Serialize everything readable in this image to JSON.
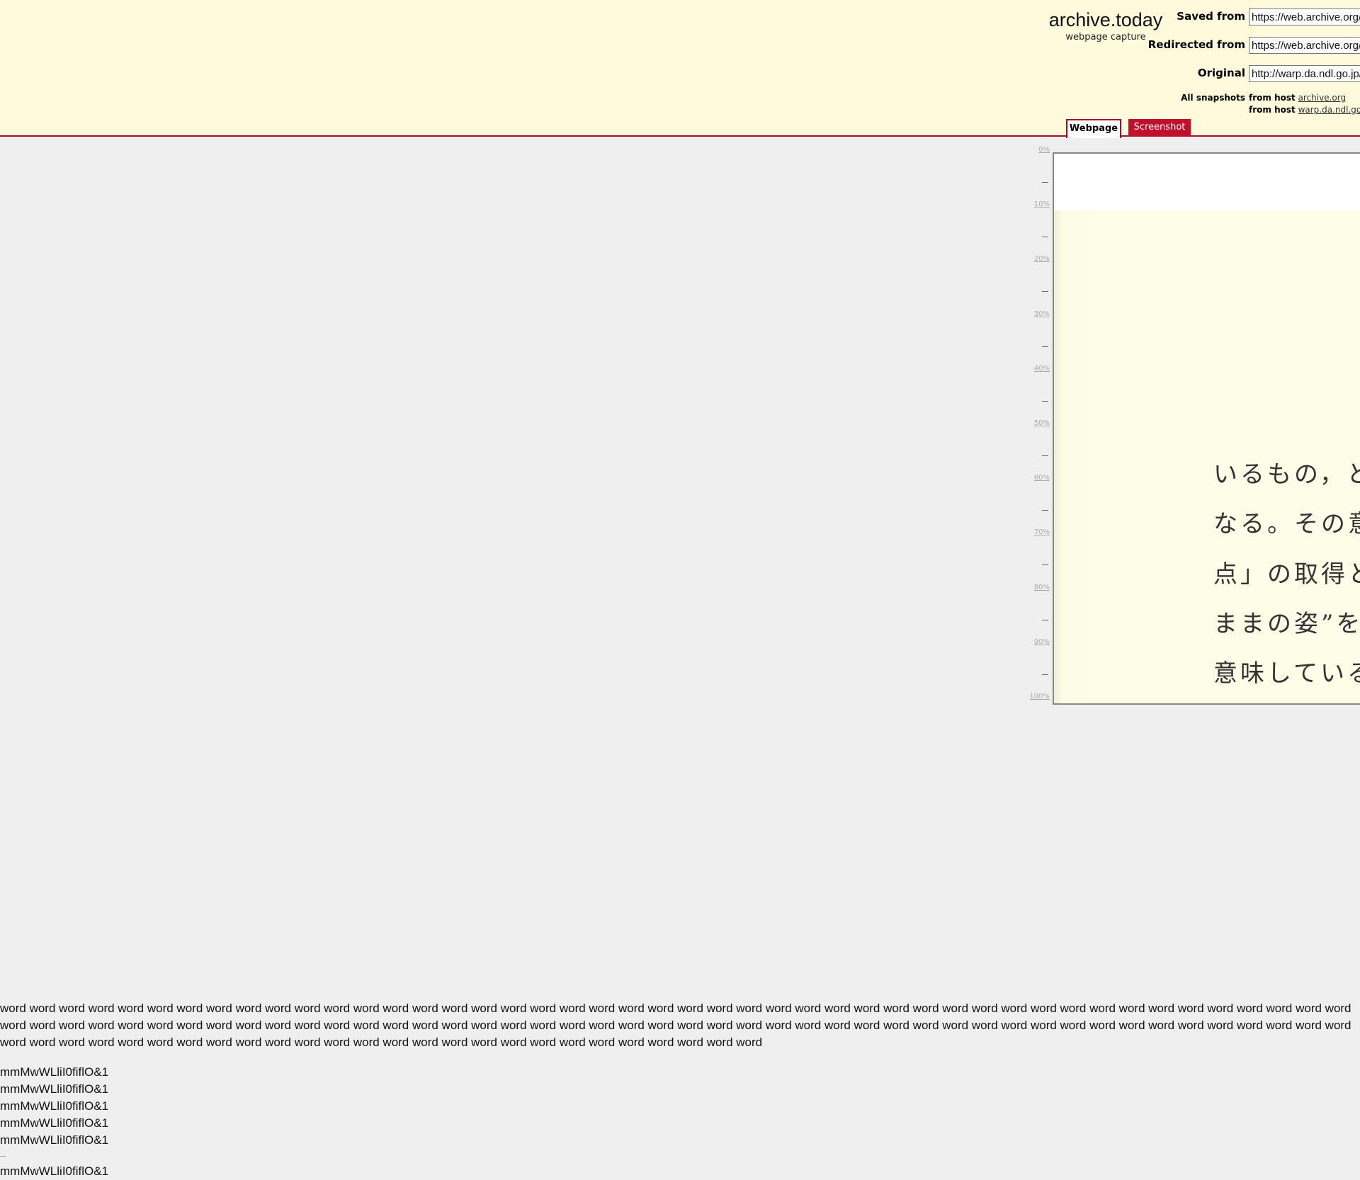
{
  "header": {
    "brand_title": "archive.today",
    "brand_subtitle": "webpage capture",
    "saved_from_label": "Saved from",
    "saved_from_value": "https://web.archive.org/web/",
    "redirected_from_label": "Redirected from",
    "redirected_from_value": "https://web.archive.org/web/",
    "original_label": "Original",
    "original_value": "http://warp.da.ndl.go.jp/",
    "all_snapshots_label": "All snapshots",
    "snapshot_rows": [
      {
        "prefix": "from host",
        "host": "archive.org"
      },
      {
        "prefix": "from host",
        "host": "warp.da.ndl.go.jp"
      }
    ],
    "tabs": {
      "webpage": "Webpage",
      "screenshot": "Screenshot"
    },
    "accent_color": "#a0102b"
  },
  "scale": {
    "labels": [
      "0%",
      "10%",
      "20%",
      "30%",
      "40%",
      "50%",
      "60%",
      "70%",
      "80%",
      "90%",
      "100%"
    ]
  },
  "preview": {
    "lines": [
      "いるもの，と",
      "なる。その意",
      "点」の取得と",
      "ままの姿”を",
      "意味している"
    ]
  },
  "content": {
    "words": "word word word word word word word word word word word word word word word word word word word word word word word word word word word word word word word word word word word word word word word word word word word word word word word word word word word word word word word word word word word word word word word word word word word word word word word word word word word word word word word word word word word word word word word word word word word word word word word word word word word word word word word word word word word word word word word word word word word word word word",
    "samples": [
      "mmMwWLliI0fiflO&1",
      "mmMwWLliI0fiflO&1",
      "mmMwWLliI0fiflO&1",
      "mmMwWLliI0fiflO&1",
      "mmMwWLliI0fiflO&1"
    ],
    "sample_after_divider": "mmMwWLliI0fiflO&1"
  }
}
